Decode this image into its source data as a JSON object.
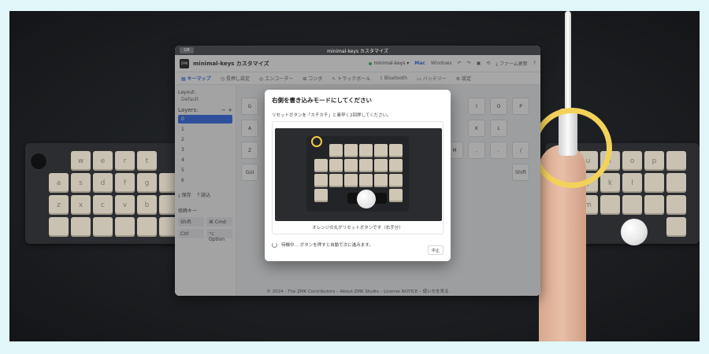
{
  "window": {
    "title": "minimal-keys カスタマイズ",
    "titlebar_badge": "GB"
  },
  "header": {
    "logo": "ZMK",
    "app_title": "minimal-keys カスタマイズ",
    "device": "minimal-keys",
    "os_mac": "Mac",
    "os_windows": "Windows",
    "firmware": "ファーム更新",
    "help": "?"
  },
  "tabs": [
    {
      "label": "キーマップ",
      "icon": "grid"
    },
    {
      "label": "長押し設定",
      "icon": "clock"
    },
    {
      "label": "エンコーダー",
      "icon": "encoder"
    },
    {
      "label": "コンボ",
      "icon": "combo"
    },
    {
      "label": "トラックボール",
      "icon": "cursor"
    },
    {
      "label": "Bluetooth",
      "icon": "bluetooth"
    },
    {
      "label": "バッテリー",
      "icon": "battery"
    },
    {
      "label": "設定",
      "icon": "gear"
    }
  ],
  "sidebar": {
    "layout_label": "Layout:",
    "layout_value": "Default",
    "layers_label": "Layers:",
    "layers": [
      "0",
      "1",
      "2",
      "3",
      "4",
      "5",
      "6"
    ],
    "save_label": "保存",
    "load_label": "読込",
    "mods_label": "修飾キー",
    "mods": [
      "Shift",
      "⌘ Cmd",
      "Ctrl",
      "⌥ Option"
    ]
  },
  "virtual_keys": [
    "G",
    "A",
    "Z",
    "GUI",
    "I",
    "O",
    "P",
    "K",
    "L",
    "M",
    ",",
    ".",
    "/",
    "Shift"
  ],
  "footer": "© 2024 - The ZMK Contributors – About ZMK Studio – License NOTICE – 使い方を見る",
  "modal": {
    "title": "右側を書き込みモードにしてください",
    "description": "リセットボタンを「カチカチ」と素早く2回押してください。",
    "caption": "オレンジの丸がリセットボタンです（右手分）",
    "status": "待機中… ボタンを押すと自動で次に進みます。",
    "stop_label": "中止"
  },
  "colors": {
    "accent": "#2563eb",
    "ring": "#f3d25a",
    "page_bg": "#e0f6f8"
  }
}
